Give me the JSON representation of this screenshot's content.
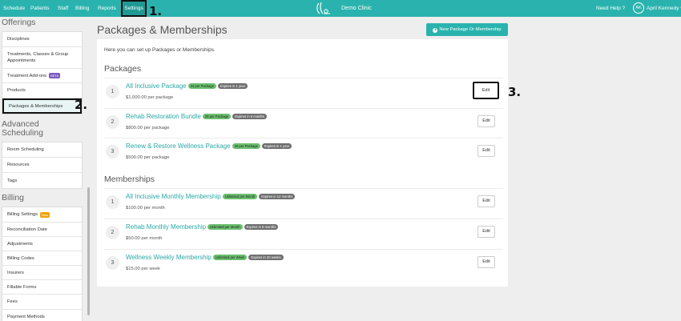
{
  "topnav": {
    "items": [
      "Schedule",
      "Patients",
      "Staff",
      "Billing",
      "Reports",
      "Settings"
    ],
    "clinic_name": "Demo Clinic",
    "help": "Need Help ?",
    "avatar_initials": "AK",
    "user_name": "April Kennedy",
    "accent_color": "#2ab3ae"
  },
  "callouts": [
    "1.",
    "2.",
    "3."
  ],
  "sidebar": {
    "offerings_heading": "Offerings",
    "offerings": [
      "Disciplines",
      "Treatments, Classes & Group Appointments",
      "Treatment Add-ons",
      "Products",
      "Packages & Memberships"
    ],
    "treatment_addons_badge": "BETA",
    "advanced_heading": "Advanced Scheduling",
    "advanced": [
      "Room Scheduling",
      "Resources",
      "Tags"
    ],
    "billing_heading": "Billing",
    "billing": [
      "Billing Settings",
      "Reconciliation Date",
      "Adjustments",
      "Billing Codes",
      "Insurers",
      "Fillable Forms",
      "Fees",
      "Payment Methods"
    ],
    "billing_settings_badge": "New"
  },
  "main": {
    "title": "Packages & Memberships",
    "new_button": "New Package Or Membership",
    "intro": "Here you can set up Packages or Memberships.",
    "packages_heading": "Packages",
    "memberships_heading": "Memberships",
    "edit_label": "Edit",
    "packages": [
      {
        "num": "1",
        "name": "All Inclusive Package",
        "qty": "24 per Package",
        "expires": "Expires in 1 year",
        "price": "$1,000.00 per package"
      },
      {
        "num": "2",
        "name": "Rehab Restoration Bundle",
        "qty": "20 per Package",
        "expires": "Expires in 6 months",
        "price": "$800.00 per package"
      },
      {
        "num": "3",
        "name": "Renew & Restore Wellness Package",
        "qty": "10 per Package",
        "expires": "Expires in 1 year",
        "price": "$500.00 per package"
      }
    ],
    "memberships": [
      {
        "num": "1",
        "name": "All Inclusive Monthly Membership",
        "qty": "Unlimited per Month",
        "expires": "Expires in 12 months",
        "price": "$100.00 per month"
      },
      {
        "num": "2",
        "name": "Rehab Monthly Membership",
        "qty": "Unlimited per Month",
        "expires": "Expires in 6 months",
        "price": "$50.00 per month"
      },
      {
        "num": "3",
        "name": "Wellness Weekly Membership",
        "qty": "Unlimited per Week",
        "expires": "Expires in 20 weeks",
        "price": "$15.00 per week"
      }
    ]
  }
}
